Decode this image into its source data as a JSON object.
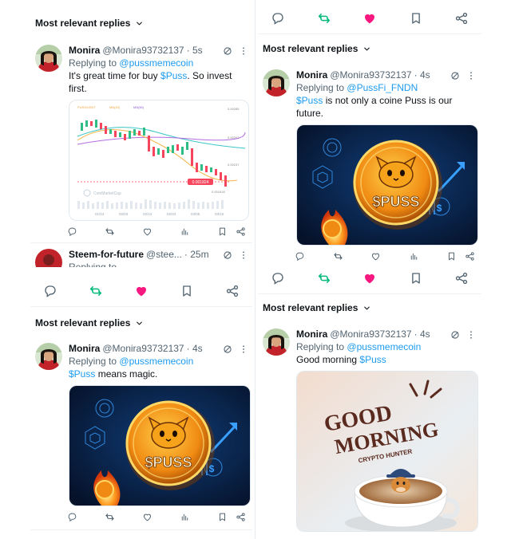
{
  "colors": {
    "accent": "#1d9bf0",
    "repost": "#00ba7c",
    "like": "#f91880",
    "muted": "#536471"
  },
  "section_header": "Most relevant replies",
  "panel_a": {
    "reply": {
      "name": "Monira",
      "handle": "@Monira93732137",
      "time": "· 5s",
      "replying_prefix": "Replying to",
      "replying_handle": "@pussmemecoin",
      "text_pre": "It's great time for buy ",
      "cashtag": "$Puss",
      "text_post": ". So invest first.",
      "chart": {
        "tags": [
          "PUSS/USDT",
          "MA(20)",
          "MA(50)"
        ],
        "price_right": [
          "0.00285",
          "0.00261",
          "0.00237",
          "0.00213"
        ],
        "current_price": "0.001824",
        "low_price": "0.001616",
        "x_ticks": [
          "01/24",
          "02/03",
          "02/13",
          "02/23",
          "03/05",
          "03/15"
        ],
        "watermark": "CoinMarketCap"
      }
    },
    "next_reply": {
      "name": "Steem-for-future",
      "handle": "@stee...",
      "time": "· 25m",
      "replying_prefix": "Replying to"
    }
  },
  "panel_b": {
    "reply": {
      "name": "Monira",
      "handle": "@Monira93732137",
      "time": "· 4s",
      "replying_prefix": "Replying to",
      "replying_handle": "@pussmemecoin",
      "cashtag": "$Puss",
      "text_post": " means magic.",
      "coin_text": "$PUSS"
    }
  },
  "panel_c": {
    "reply": {
      "name": "Monira",
      "handle": "@Monira93732137",
      "time": "· 4s",
      "replying_prefix": "Replying to",
      "replying_handle": "@PussFi_FNDN",
      "cashtag": "$Puss",
      "text_post": " is not only a coine Puss is our future.",
      "coin_text": "$PUSS"
    }
  },
  "panel_d": {
    "reply": {
      "name": "Monira",
      "handle": "@Monira93732137",
      "time": "· 4s",
      "replying_prefix": "Replying to",
      "replying_handle": "@pussmemecoin",
      "text_pre": "Good morning ",
      "cashtag": "$Puss",
      "image_text": {
        "line1": "GOOD",
        "line2": "MORNING",
        "line3": "CRYPTO HUNTER"
      }
    }
  }
}
